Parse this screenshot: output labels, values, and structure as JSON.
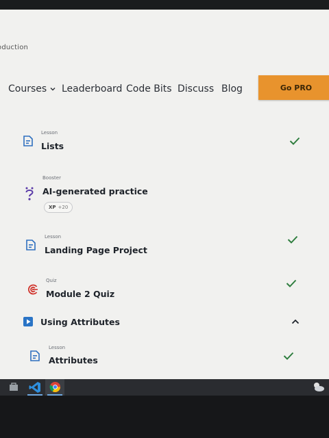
{
  "breadcrumb": "oduction",
  "nav": {
    "courses": "Courses",
    "leaderboard": "Leaderboard",
    "code_bits": "Code Bits",
    "discuss": "Discuss",
    "blog": "Blog",
    "go_pro": "Go PRO"
  },
  "items": [
    {
      "kind": "Lesson",
      "title": "Lists",
      "completed": true,
      "icon": "lesson-icon"
    },
    {
      "kind": "Booster",
      "title": "AI-generated practice",
      "completed": false,
      "icon": "question-icon",
      "xp_label": "XP",
      "xp_value": "+20"
    },
    {
      "kind": "Lesson",
      "title": "Landing Page Project",
      "completed": true,
      "icon": "lesson-icon"
    },
    {
      "kind": "Quiz",
      "title": "Module 2 Quiz",
      "completed": true,
      "icon": "target-icon"
    }
  ],
  "section": {
    "title": "Using Attributes",
    "expanded": true
  },
  "section_items": [
    {
      "kind": "Lesson",
      "title": "Attributes",
      "completed": true,
      "icon": "lesson-icon"
    }
  ],
  "colors": {
    "accent": "#e8932d",
    "check": "#2e7d3e",
    "lesson_icon": "#2e6fbf",
    "quiz_icon": "#d0342c",
    "section_icon": "#2a74c6"
  }
}
